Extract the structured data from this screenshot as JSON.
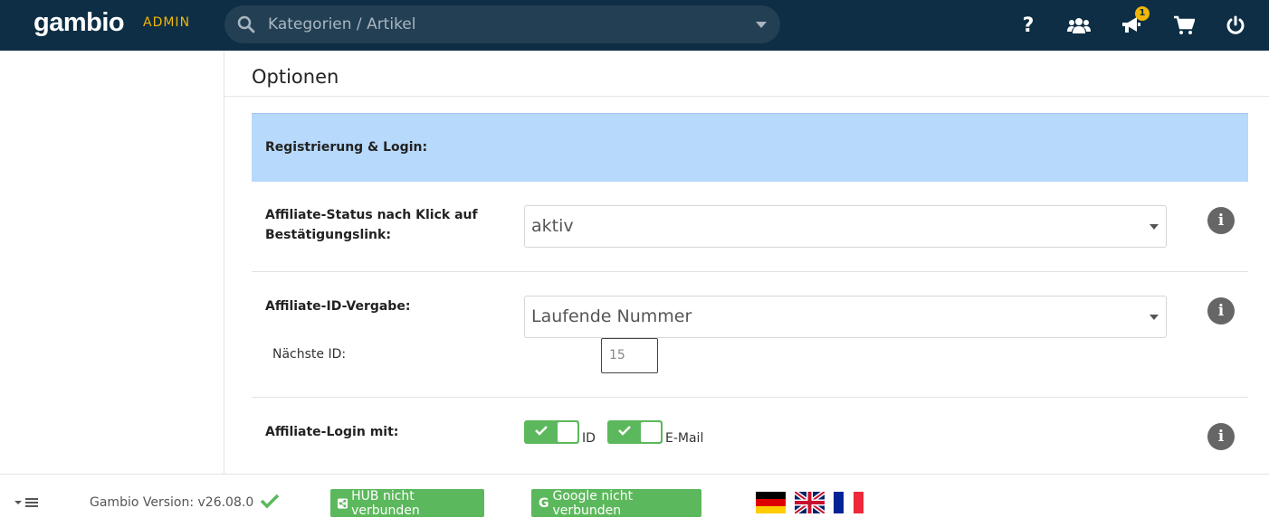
{
  "header": {
    "logo_text": "gambio",
    "admin_label": "ADMIN",
    "search_placeholder": "Kategorien / Artikel",
    "notification_count": "1",
    "icons": [
      "help-icon",
      "users-icon",
      "megaphone-icon",
      "cart-icon",
      "power-icon"
    ],
    "brand_color": "#0d2e44",
    "accent_color": "#f2b705"
  },
  "main": {
    "title": "Optionen",
    "section_title": "Registrierung & Login:",
    "rows": [
      {
        "label": "Affiliate-Status nach Klick auf Bestätigungslink:",
        "value": "aktiv"
      },
      {
        "label": "Affiliate-ID-Vergabe:",
        "value": "Laufende Nummer",
        "next_id_label": "Nächste ID:",
        "next_id_value": "15"
      },
      {
        "label": "Affiliate-Login mit:",
        "toggles": [
          {
            "label": "ID",
            "on": true
          },
          {
            "label": "E-Mail",
            "on": true
          }
        ]
      }
    ],
    "section_color": "#b7d9fb",
    "toggle_color": "#5cb85c"
  },
  "footer": {
    "version": "Gambio Version: v26.08.0",
    "hub_button": "HUB nicht verbunden",
    "google_button": "Google nicht verbunden",
    "languages": [
      "de-flag",
      "gb-flag",
      "fr-flag"
    ]
  }
}
